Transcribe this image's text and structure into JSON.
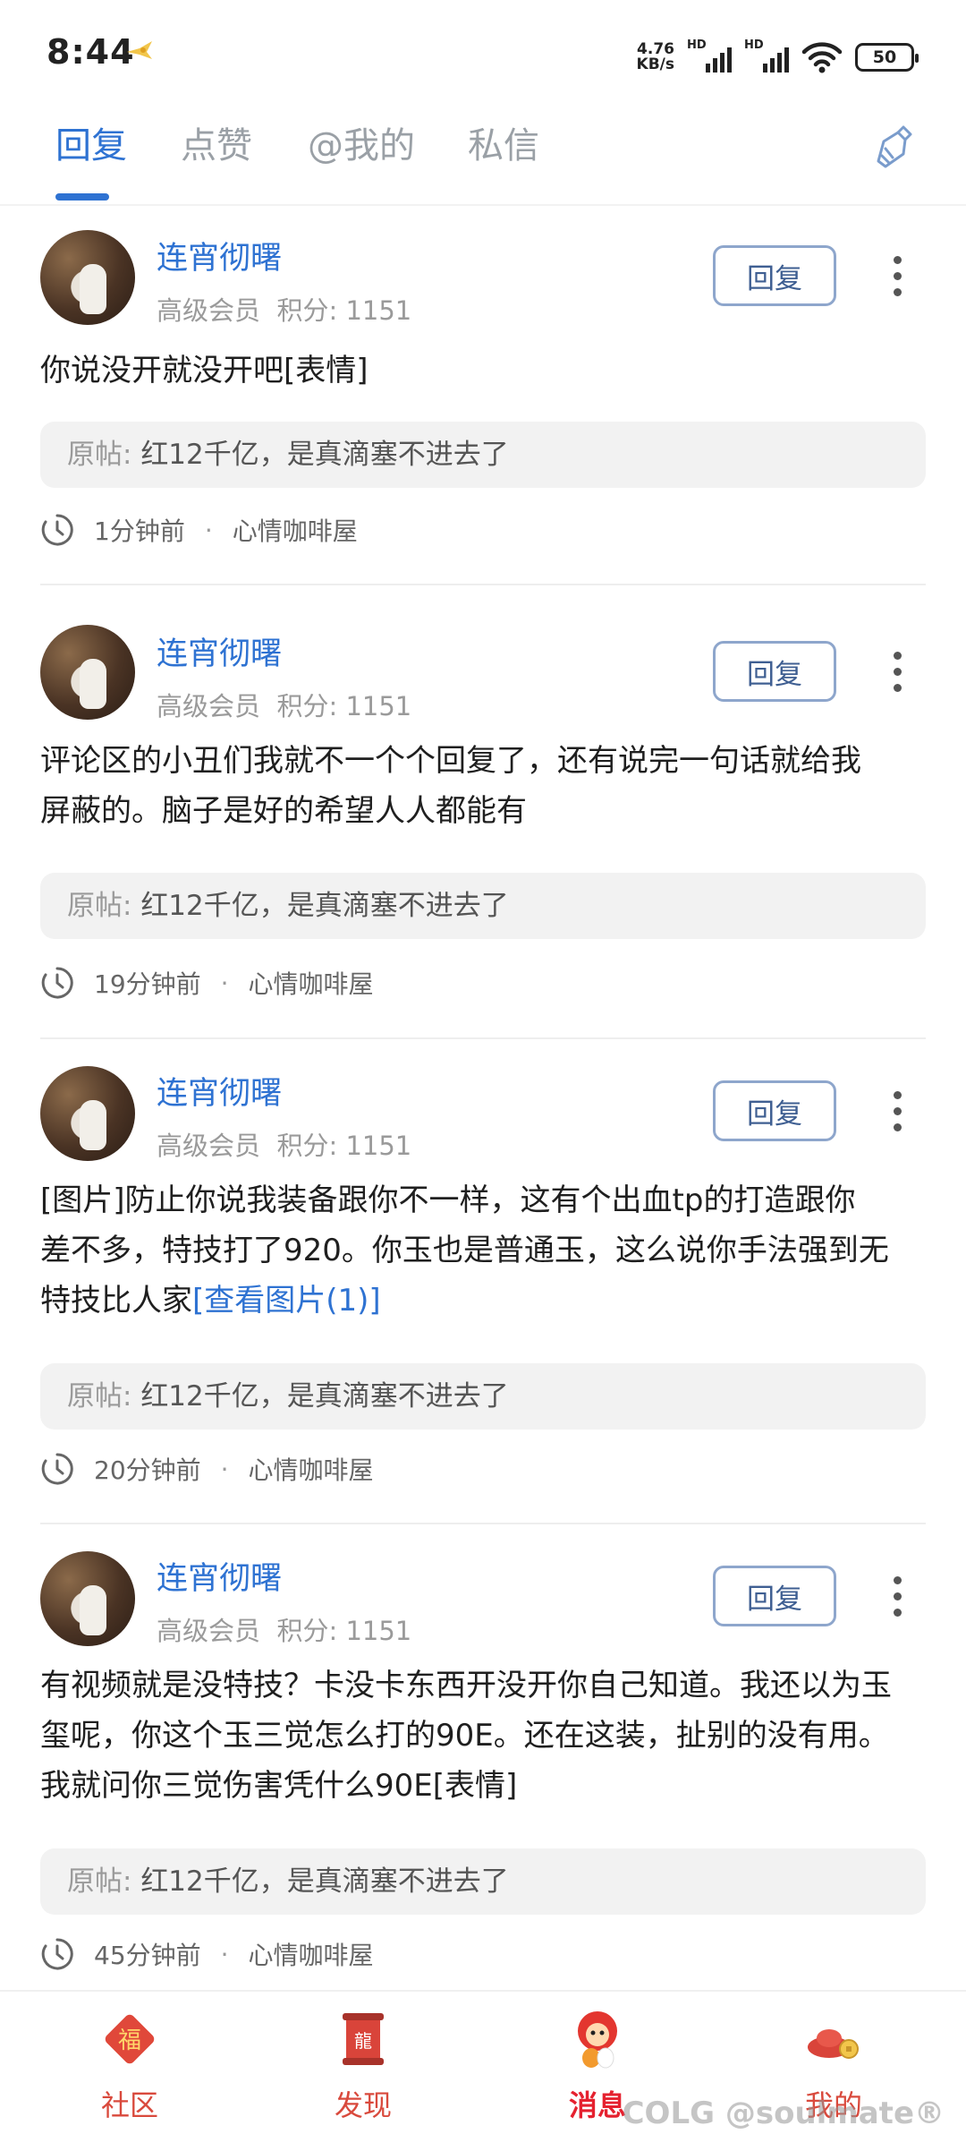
{
  "status": {
    "time": "8:44",
    "net_speed_top": "4.76",
    "net_speed_unit": "KB/s",
    "hd_label": "HD",
    "battery": "50"
  },
  "tabs": [
    {
      "label": "回复",
      "active": true
    },
    {
      "label": "点赞",
      "active": false
    },
    {
      "label": "@我的",
      "active": false
    },
    {
      "label": "私信",
      "active": false
    }
  ],
  "posts": [
    {
      "user": "连宵彻曙",
      "level": "高级会员",
      "score": "积分: 1151",
      "reply_label": "回复",
      "content": "你说没开就没开吧[表情]",
      "orig_prefix": "原帖:",
      "orig_title": "红12千亿，是真滴塞不进去了",
      "time": "1分钟前",
      "forum": "心情咖啡屋"
    },
    {
      "user": "连宵彻曙",
      "level": "高级会员",
      "score": "积分: 1151",
      "reply_label": "回复",
      "content_lines": [
        "评论区的小丑们我就不一个个回复了，还有说完一句话就给我",
        "屏蔽的。脑子是好的希望人人都能有"
      ],
      "orig_prefix": "原帖:",
      "orig_title": "红12千亿，是真滴塞不进去了",
      "time": "19分钟前",
      "forum": "心情咖啡屋"
    },
    {
      "user": "连宵彻曙",
      "level": "高级会员",
      "score": "积分: 1151",
      "reply_label": "回复",
      "content_lines": [
        "[图片]防止你说我装备跟你不一样，这有个出血tp的打造跟你",
        "差不多，特技打了920。你玉也是普通玉，这么说你手法强到无",
        "特技比人家"
      ],
      "content_link": "[查看图片(1)]",
      "orig_prefix": "原帖:",
      "orig_title": "红12千亿，是真滴塞不进去了",
      "time": "20分钟前",
      "forum": "心情咖啡屋"
    },
    {
      "user": "连宵彻曙",
      "level": "高级会员",
      "score": "积分: 1151",
      "reply_label": "回复",
      "content_lines": [
        "有视频就是没特技？卡没卡东西开没开你自己知道。我还以为玉",
        "玺呢，你这个玉三觉怎么打的90E。还在这装，扯别的没有用。",
        "我就问你三觉伤害凭什么90E[表情]"
      ],
      "orig_prefix": "原帖:",
      "orig_title": "红12千亿，是真滴塞不进去了",
      "time": "45分钟前",
      "forum": "心情咖啡屋"
    }
  ],
  "nav": [
    {
      "label": "社区",
      "icon": "fu-lantern-icon"
    },
    {
      "label": "发现",
      "icon": "dragon-scroll-icon"
    },
    {
      "label": "消息",
      "icon": "lion-mascot-icon",
      "active": true
    },
    {
      "label": "我的",
      "icon": "gold-ingot-icon"
    }
  ],
  "watermark": "COLG @soulmate®",
  "colors": {
    "accent": "#2e72d2",
    "nav_red": "#d94a3d"
  }
}
